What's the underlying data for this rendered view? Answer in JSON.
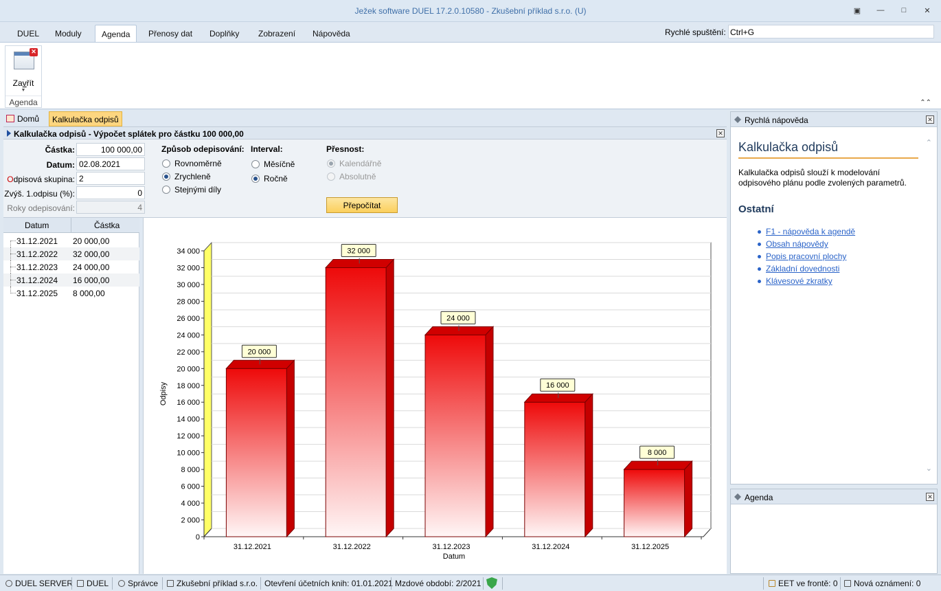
{
  "window": {
    "title": "Ježek software DUEL 17.2.0.10580 - Zkušební příklad s.r.o. (U)"
  },
  "menu": {
    "items": [
      "DUEL",
      "Moduly",
      "Agenda",
      "Přenosy dat",
      "Doplňky",
      "Zobrazení",
      "Nápověda"
    ],
    "active": "Agenda",
    "quick_launch_label": "Rychlé spuštění:",
    "quick_launch_value": "Ctrl+G"
  },
  "ribbon": {
    "close_label_prefix": "Za",
    "close_label_underlined": "v",
    "close_label_suffix": "řít",
    "group_label": "Agenda"
  },
  "doc_tabs": {
    "home": "Domů",
    "active": "Kalkulačka odpisů"
  },
  "panel": {
    "title": "Kalkulačka odpisů - Výpočet splátek pro částku 100 000,00"
  },
  "form": {
    "amount_label": "Částka:",
    "amount_value": "100 000,00",
    "date_label": "Datum:",
    "date_value": "02.08.2021",
    "group_label_first": "O",
    "group_label_rest": "dpisová skupina:",
    "group_value": "2",
    "increase_label": "Zvýš. 1.odpisu (%):",
    "increase_value": "0",
    "years_label": "Roky odepisování:",
    "years_value": "4",
    "method_head": "Způsob odepisování:",
    "method_options": [
      "Rovnoměrně",
      "Zrychleně",
      "Stejnými díly"
    ],
    "method_selected": 1,
    "interval_head": "Interval:",
    "interval_options": [
      "Měsíčně",
      "Ročně"
    ],
    "interval_selected": 1,
    "precision_head": "Přesnost:",
    "precision_options": [
      "Kalendářně",
      "Absolutně"
    ],
    "precision_selected": 0,
    "recalc_button": "Přepočítat"
  },
  "grid": {
    "col_date": "Datum",
    "col_amount": "Částka",
    "rows": [
      {
        "date": "31.12.2021",
        "amount": "20 000,00"
      },
      {
        "date": "31.12.2022",
        "amount": "32 000,00"
      },
      {
        "date": "31.12.2023",
        "amount": "24 000,00"
      },
      {
        "date": "31.12.2024",
        "amount": "16 000,00"
      },
      {
        "date": "31.12.2025",
        "amount": "8 000,00"
      }
    ]
  },
  "chart_data": {
    "type": "bar",
    "categories": [
      "31.12.2021",
      "31.12.2022",
      "31.12.2023",
      "31.12.2024",
      "31.12.2025"
    ],
    "values": [
      20000,
      32000,
      24000,
      16000,
      8000
    ],
    "data_labels": [
      "20 000",
      "32 000",
      "24 000",
      "16 000",
      "8 000"
    ],
    "xlabel": "Datum",
    "ylabel": "Odpisy",
    "ylim": [
      0,
      34000
    ],
    "yticks": [
      0,
      2000,
      4000,
      6000,
      8000,
      10000,
      12000,
      14000,
      16000,
      18000,
      20000,
      22000,
      24000,
      26000,
      28000,
      30000,
      32000,
      34000
    ],
    "ytick_labels": [
      "0",
      "2 000",
      "4 000",
      "6 000",
      "8 000",
      "10 000",
      "12 000",
      "14 000",
      "16 000",
      "18 000",
      "20 000",
      "22 000",
      "24 000",
      "26 000",
      "28 000",
      "30 000",
      "32 000",
      "34 000"
    ],
    "grid": true,
    "bar_color": "#e8090c",
    "wall_color": "#ffff66"
  },
  "help": {
    "panel_title": "Rychlá nápověda",
    "heading": "Kalkulačka odpisů",
    "text": "Kalkulačka odpisů slouží k modelování odpisového plánu podle zvolených parametrů.",
    "subheading": "Ostatní",
    "links": [
      "F1 - nápověda k agendě",
      "Obsah nápovědy",
      "Popis pracovní plochy",
      "Základní dovednosti",
      "Klávesové zkratky"
    ]
  },
  "agenda_panel": {
    "title": "Agenda"
  },
  "status": {
    "server": "DUEL SERVER",
    "app": "DUEL",
    "user": "Správce",
    "company": "Zkušební příklad s.r.o.",
    "books": "Otevření účetních knih: 01.01.2021",
    "period": "Mzdové období: 2/2021",
    "eet": "EET ve frontě: 0",
    "notices": "Nová oznámení: 0"
  }
}
